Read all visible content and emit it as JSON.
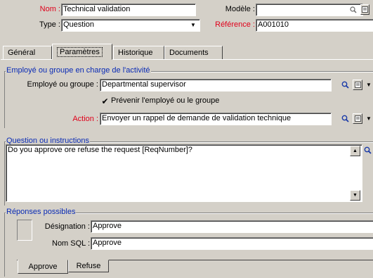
{
  "header": {
    "name_label": "Nom :",
    "name_value": "Technical validation",
    "model_label": "Modèle :",
    "model_value": "",
    "type_label": "Type :",
    "type_value": "Question",
    "reference_label": "Référence :",
    "reference_value": "A001010"
  },
  "tabs": [
    {
      "label": "Général"
    },
    {
      "label": "Paramètres"
    },
    {
      "label": "Historique"
    },
    {
      "label": "Documents"
    }
  ],
  "active_tab": "Paramètres",
  "employee_group": {
    "title": "Employé ou groupe en charge de l'activité",
    "employee_label": "Employé ou groupe :",
    "employee_value": "Departmental supervisor",
    "notify_label": "Prévenir l'employé ou le groupe",
    "notify_checked": true,
    "action_label": "Action :",
    "action_value": "Envoyer un rappel de demande de validation technique"
  },
  "question": {
    "title": "Question ou instructions",
    "text": "Do you approve ore refuse the request [ReqNumber]?"
  },
  "responses": {
    "title": "Réponses possibles",
    "designation_label": "Désignation :",
    "designation_value": "Approve",
    "sqlname_label": "Nom SQL :",
    "sqlname_value": "Approve",
    "tabs": [
      {
        "label": "Approve"
      },
      {
        "label": "Refuse"
      }
    ]
  },
  "colors": {
    "required_label": "#e0001a",
    "group_title": "#0a2bb5",
    "window_bg": "#d4d0c8"
  },
  "icons": {
    "lookup": "magnifier-icon",
    "details": "details-icon",
    "dropdown": "chevron-down-icon"
  }
}
